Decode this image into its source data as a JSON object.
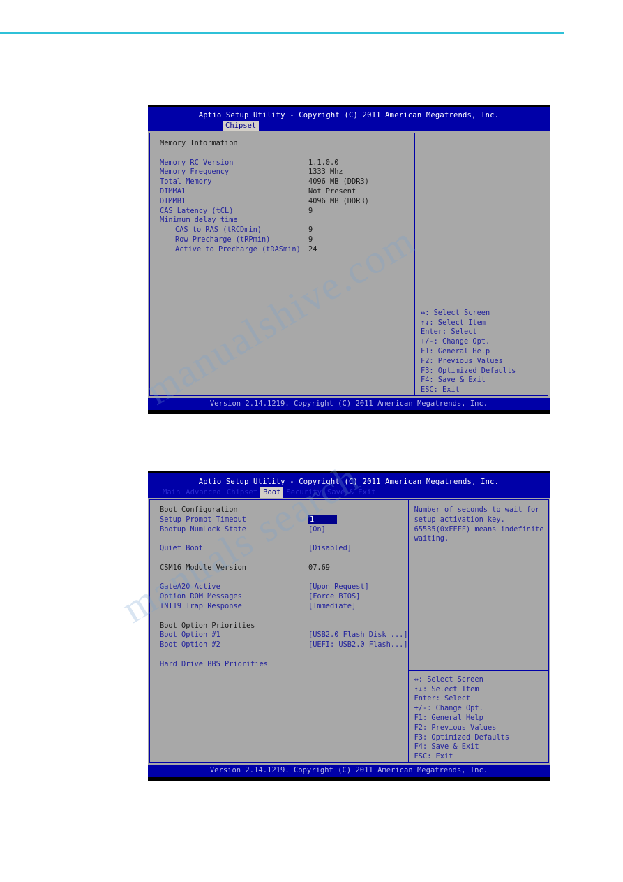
{
  "page": {
    "rule_color": "#2fc1d8",
    "watermark_line1": "manualshive.com",
    "watermark_line2": "manuals search"
  },
  "screens": [
    {
      "id": "chipset",
      "title": "Aptio Setup Utility - Copyright (C) 2011 American Megatrends, Inc.",
      "tabs": [
        {
          "label": "Chipset",
          "active": true
        }
      ],
      "rows": [
        {
          "kind": "header",
          "label": "Memory Information",
          "value": ""
        },
        {
          "kind": "gap"
        },
        {
          "kind": "item",
          "label": "Memory RC Version",
          "value": "1.1.0.0"
        },
        {
          "kind": "item",
          "label": "Memory Frequency",
          "value": "1333 Mhz"
        },
        {
          "kind": "item",
          "label": "Total Memory",
          "value": "4096 MB (DDR3)"
        },
        {
          "kind": "item",
          "label": "DIMMA1",
          "value": "Not Present"
        },
        {
          "kind": "item",
          "label": "DIMMB1",
          "value": "4096 MB (DDR3)"
        },
        {
          "kind": "item",
          "label": "CAS Latency (tCL)",
          "value": "9"
        },
        {
          "kind": "item",
          "label": "Minimum delay time",
          "value": ""
        },
        {
          "kind": "indent",
          "label": "CAS to RAS (tRCDmin)",
          "value": "9"
        },
        {
          "kind": "indent",
          "label": "Row Precharge (tRPmin)",
          "value": "9"
        },
        {
          "kind": "indent",
          "label": "Active to Precharge (tRASmin)",
          "value": "24"
        }
      ],
      "help_lines": [],
      "legend": [
        "↔: Select Screen",
        "↑↓: Select Item",
        "Enter: Select",
        "+/-: Change Opt.",
        "F1: General Help",
        "F2: Previous Values",
        "F3: Optimized Defaults",
        "F4: Save & Exit",
        "ESC: Exit"
      ],
      "footer": "Version 2.14.1219. Copyright (C) 2011 American Megatrends, Inc."
    },
    {
      "id": "boot",
      "title": "Aptio Setup Utility - Copyright (C) 2011 American Megatrends, Inc.",
      "tabs": [
        {
          "label": "Main",
          "active": false
        },
        {
          "label": "Advanced",
          "active": false
        },
        {
          "label": "Chipset",
          "active": false
        },
        {
          "label": "Boot",
          "active": true
        },
        {
          "label": "Security",
          "active": false
        },
        {
          "label": "Save & Exit",
          "active": false
        }
      ],
      "rows": [
        {
          "kind": "header",
          "label": "Boot Configuration",
          "value": ""
        },
        {
          "kind": "selected",
          "label": "Setup Prompt Timeout",
          "value": "1"
        },
        {
          "kind": "item",
          "label": "Bootup NumLock State",
          "value": "[On]"
        },
        {
          "kind": "gap"
        },
        {
          "kind": "item",
          "label": "Quiet Boot",
          "value": "[Disabled]"
        },
        {
          "kind": "gap"
        },
        {
          "kind": "plain",
          "label": "CSM16 Module Version",
          "value": "07.69"
        },
        {
          "kind": "gap"
        },
        {
          "kind": "item",
          "label": "GateA20 Active",
          "value": "[Upon Request]"
        },
        {
          "kind": "item",
          "label": "Option ROM Messages",
          "value": "[Force BIOS]"
        },
        {
          "kind": "item",
          "label": "INT19 Trap Response",
          "value": "[Immediate]"
        },
        {
          "kind": "gap"
        },
        {
          "kind": "header",
          "label": "Boot Option Priorities",
          "value": ""
        },
        {
          "kind": "item",
          "label": "Boot Option #1",
          "value": "[USB2.0 Flash Disk ...]"
        },
        {
          "kind": "item",
          "label": "Boot Option #2",
          "value": "[UEFI: USB2.0 Flash...]"
        },
        {
          "kind": "gap"
        },
        {
          "kind": "item",
          "label": "Hard Drive BBS Priorities",
          "value": ""
        }
      ],
      "help_lines": [
        "Number of seconds to wait for",
        "setup activation key.",
        "65535(0xFFFF) means indefinite",
        "waiting."
      ],
      "legend": [
        "↔: Select Screen",
        "↑↓: Select Item",
        "Enter: Select",
        "+/-: Change Opt.",
        "F1: General Help",
        "F2: Previous Values",
        "F3: Optimized Defaults",
        "F4: Save & Exit",
        "ESC: Exit"
      ],
      "footer": "Version 2.14.1219. Copyright (C) 2011 American Megatrends, Inc."
    }
  ]
}
